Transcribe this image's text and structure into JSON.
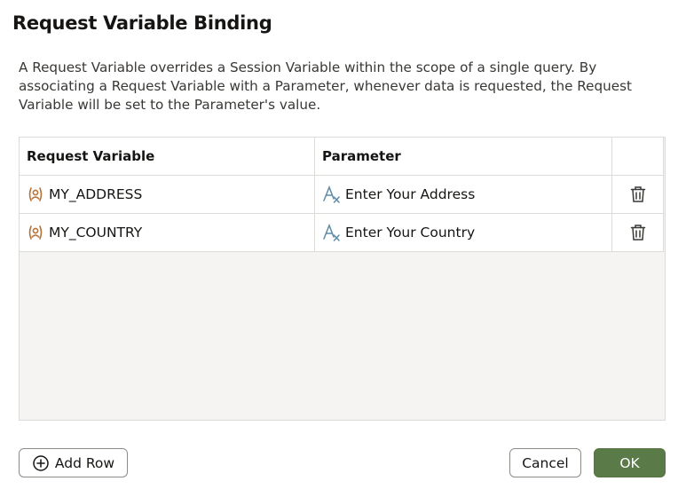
{
  "dialog": {
    "title": "Request Variable Binding",
    "description": "A Request Variable overrides a Session Variable within the scope of a single query. By associating a Request Variable with a Parameter, whenever data is requested, the Request Variable will be set to the Parameter's value."
  },
  "grid": {
    "headers": {
      "request_variable": "Request Variable",
      "parameter": "Parameter",
      "actions": ""
    },
    "rows": [
      {
        "request_variable": "MY_ADDRESS",
        "parameter": "Enter Your Address",
        "var_icon": "user-variable-icon",
        "param_icon": "parameter-fx-icon",
        "action_icon": "trash-icon"
      },
      {
        "request_variable": "MY_COUNTRY",
        "parameter": "Enter Your Country",
        "var_icon": "user-variable-icon",
        "param_icon": "parameter-fx-icon",
        "action_icon": "trash-icon"
      }
    ]
  },
  "buttons": {
    "add_row": "Add Row",
    "cancel": "Cancel",
    "ok": "OK"
  },
  "colors": {
    "primary": "#5a7a47",
    "variable_icon": "#b5733a",
    "parameter_icon": "#5f8aa6",
    "border": "#dcdbd7"
  }
}
